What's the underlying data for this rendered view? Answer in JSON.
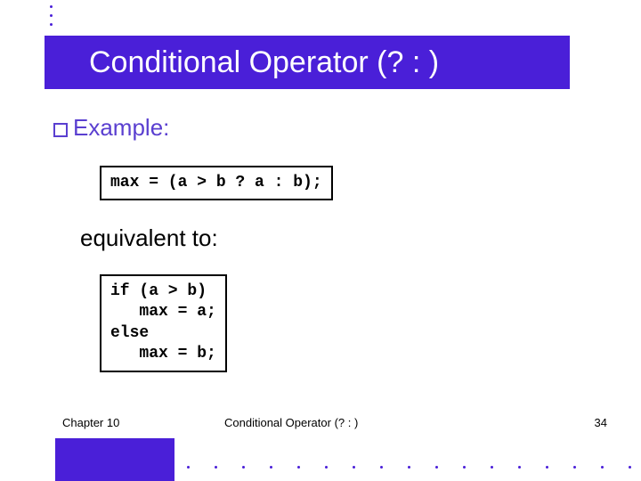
{
  "title": "Conditional Operator (? : )",
  "bullets": {
    "example": "Example:"
  },
  "code": {
    "ternary": "max = (a > b ? a : b);",
    "ifelse": "if (a > b)\n   max = a;\nelse\n   max = b;"
  },
  "equivalent_label": "equivalent to:",
  "footer": {
    "chapter": "Chapter 10",
    "center": "Conditional Operator (? : )",
    "page": "34"
  }
}
